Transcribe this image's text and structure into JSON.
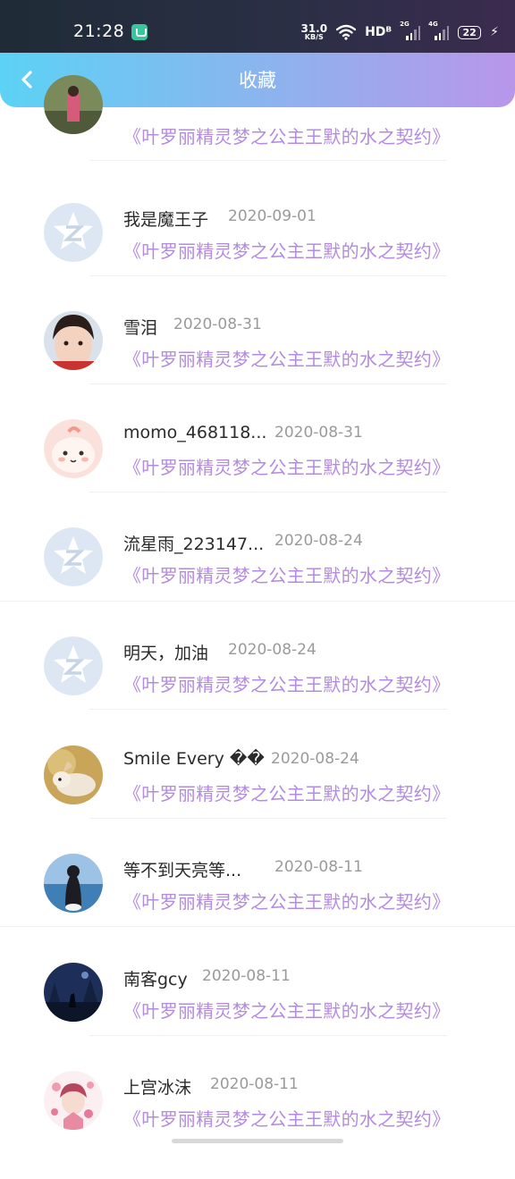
{
  "status_bar": {
    "time": "21:28",
    "net_speed_value": "31.0",
    "net_speed_unit": "KB/S",
    "hd_label": "HDᴮ",
    "sim1_label": "2G",
    "sim2_label": "4G",
    "battery": "22",
    "icons": [
      "app-notification-icon",
      "wifi-icon",
      "signal-icon",
      "battery-icon",
      "charging-icon"
    ]
  },
  "header": {
    "title": "收藏",
    "back_icon": "chevron-left-icon"
  },
  "favorites": [
    {
      "name": "",
      "date": "",
      "book": "《叶罗丽精灵梦之公主王默的水之契约》",
      "avatar": "photo-garden"
    },
    {
      "name": "我是魔王子",
      "date": "2020-09-01",
      "book": "《叶罗丽精灵梦之公主王默的水之契约》",
      "avatar": "default-qq"
    },
    {
      "name": "雪泪",
      "date": "2020-08-31",
      "book": "《叶罗丽精灵梦之公主王默的水之契约》",
      "avatar": "photo-girl"
    },
    {
      "name": "momo_468118...",
      "date": "2020-08-31",
      "book": "《叶罗丽精灵梦之公主王默的水之契约》",
      "avatar": "cartoon-pink"
    },
    {
      "name": "流星雨_223147...",
      "date": "2020-08-24",
      "book": "《叶罗丽精灵梦之公主王默的水之契约》",
      "avatar": "default-qq"
    },
    {
      "name": "明天，加油",
      "date": "2020-08-24",
      "book": "《叶罗丽精灵梦之公主王默的水之契约》",
      "avatar": "default-qq"
    },
    {
      "name": "Smile Every ��",
      "date": "2020-08-24",
      "book": "《叶罗丽精灵梦之公主王默的水之契约》",
      "avatar": "photo-rabbit"
    },
    {
      "name": "等不到天亮等...",
      "date": "2020-08-11",
      "book": "《叶罗丽精灵梦之公主王默的水之契约》",
      "avatar": "photo-sea"
    },
    {
      "name": "南客gcy",
      "date": "2020-08-11",
      "book": "《叶罗丽精灵梦之公主王默的水之契约》",
      "avatar": "photo-forest"
    },
    {
      "name": "上宫冰沫",
      "date": "2020-08-11",
      "book": "《叶罗丽精灵梦之公主王默的水之契约》",
      "avatar": "anime-girl"
    }
  ],
  "colors": {
    "book_title": "#b38be0",
    "date": "#9a9a9a",
    "header_start": "#5cd2f5",
    "header_end": "#b996ea"
  }
}
